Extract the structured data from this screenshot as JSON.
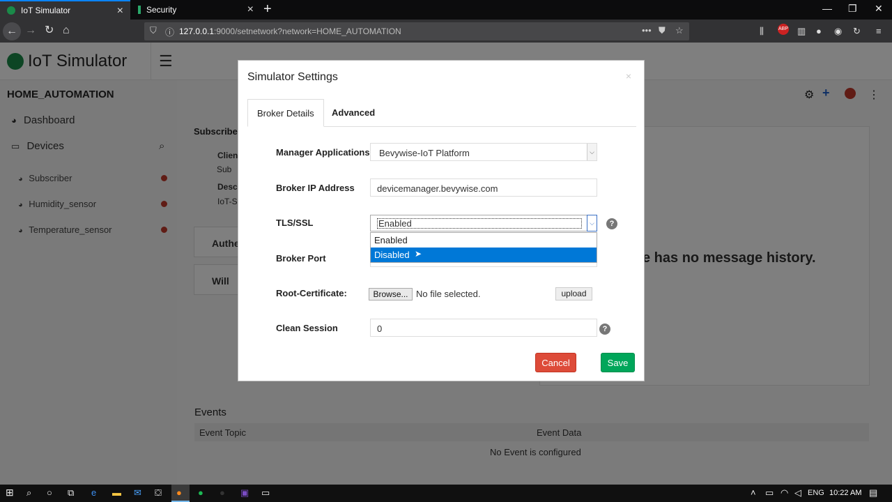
{
  "browser": {
    "tabs": [
      {
        "title": "IoT Simulator",
        "active": true
      },
      {
        "title": "Security",
        "active": false
      }
    ],
    "url_host": "127.0.0.1",
    "url_rest": ":9000/setnetwork?network=HOME_AUTOMATION"
  },
  "app": {
    "logo_text": "IoT Simulator",
    "network_name": "HOME_AUTOMATION",
    "sidebar": {
      "dashboard": "Dashboard",
      "devices": "Devices",
      "device_list": [
        "Subscriber",
        "Humidity_sensor",
        "Temperature_sensor"
      ]
    },
    "behind": {
      "subscribe_title": "Subscribe",
      "client_label": "Clien",
      "client_value": "Sub",
      "desc_label": "Desc",
      "desc_value": "IoT-S",
      "auth": "Authe",
      "will": "Will",
      "no_history": "e has no message history."
    },
    "events": {
      "title": "Events",
      "col_topic": "Event Topic",
      "col_data": "Event Data",
      "empty": "No Event is configured"
    }
  },
  "modal": {
    "title": "Simulator Settings",
    "close": "×",
    "tabs": [
      "Broker Details",
      "Advanced"
    ],
    "fields": {
      "manager_label": "Manager Applications",
      "manager_value": "Bevywise-IoT Platform",
      "broker_ip_label": "Broker IP Address",
      "broker_ip_value": "devicemanager.bevywise.com",
      "tls_label": "TLS/SSL",
      "tls_value": "Enabled",
      "tls_options": [
        "Enabled",
        "Disabled"
      ],
      "broker_port_label": "Broker Port",
      "root_cert_label": "Root-Certificate:",
      "browse_label": "Browse...",
      "no_file": "No file selected.",
      "upload_label": "upload",
      "clean_session_label": "Clean Session",
      "clean_session_value": "0",
      "help": "?"
    },
    "cancel": "Cancel",
    "save": "Save"
  },
  "taskbar": {
    "lang": "ENG",
    "time": "10:22 AM"
  },
  "colors": {
    "accent_blue": "#0078d7",
    "cancel_red": "#dd4b39",
    "save_green": "#00a65a",
    "status_red": "#c0392b"
  }
}
